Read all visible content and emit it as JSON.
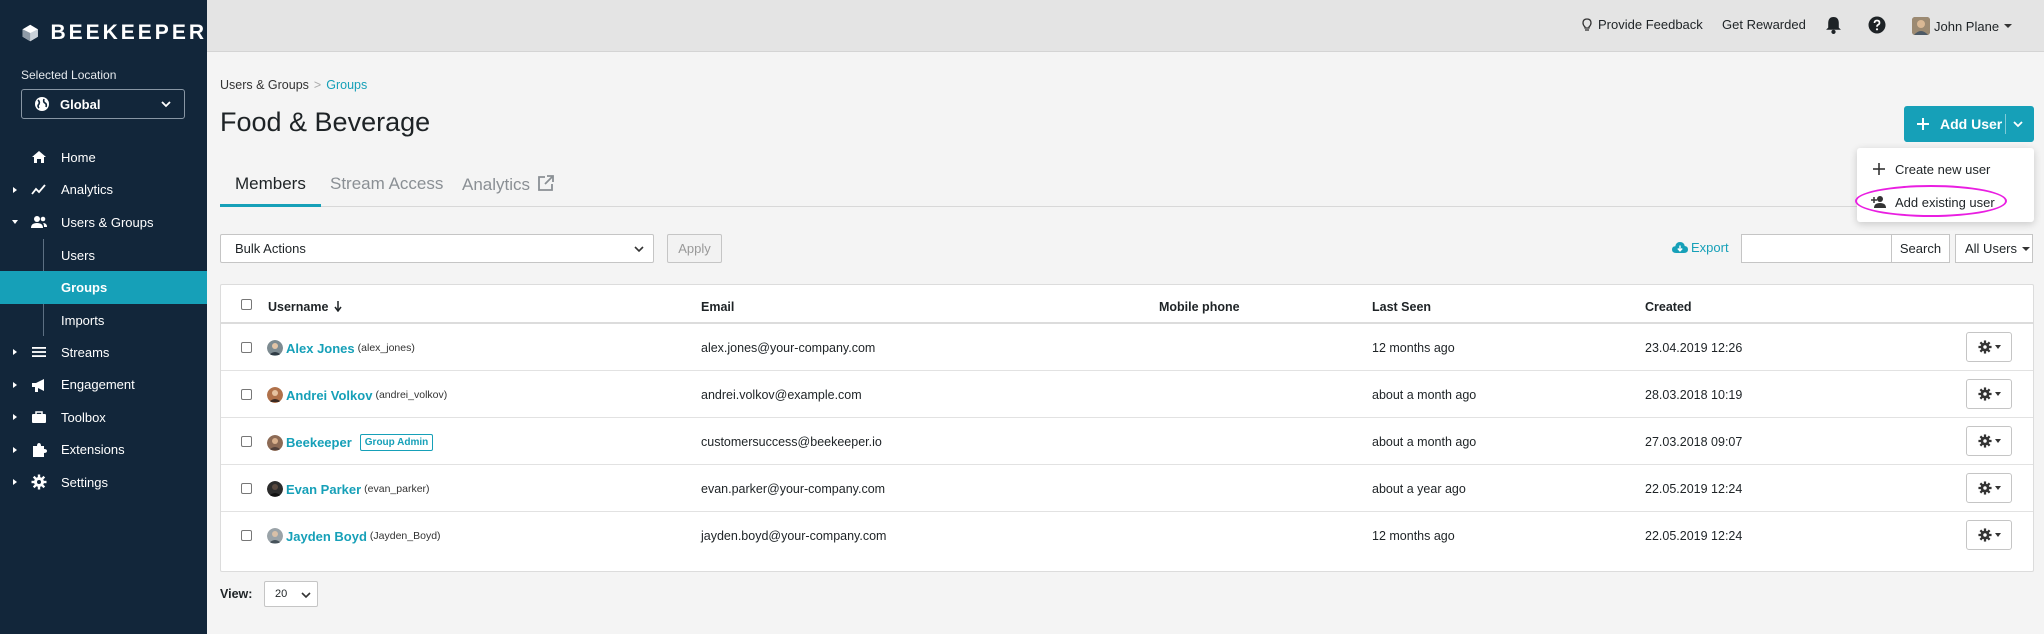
{
  "brand": {
    "name": "BEEKEEPER"
  },
  "location": {
    "label": "Selected Location",
    "value": "Global"
  },
  "sidebar": {
    "items": [
      {
        "label": "Home",
        "icon": "home-icon"
      },
      {
        "label": "Analytics",
        "icon": "analytics-icon"
      },
      {
        "label": "Users & Groups",
        "icon": "users-icon"
      },
      {
        "label": "Users"
      },
      {
        "label": "Groups"
      },
      {
        "label": "Imports"
      },
      {
        "label": "Streams",
        "icon": "streams-icon"
      },
      {
        "label": "Engagement",
        "icon": "megaphone-icon"
      },
      {
        "label": "Toolbox",
        "icon": "toolbox-icon"
      },
      {
        "label": "Extensions",
        "icon": "puzzle-icon"
      },
      {
        "label": "Settings",
        "icon": "gear-icon"
      }
    ]
  },
  "topbar": {
    "feedback": "Provide Feedback",
    "rewarded": "Get Rewarded",
    "user_name": "John Plane"
  },
  "breadcrumb": {
    "parent": "Users & Groups",
    "separator": ">",
    "current": "Groups"
  },
  "page": {
    "title": "Food & Beverage"
  },
  "tabs": [
    {
      "label": "Members"
    },
    {
      "label": "Stream Access"
    },
    {
      "label": "Analytics"
    }
  ],
  "add_user": {
    "label": "Add User",
    "menu": [
      {
        "label": "Create new user"
      },
      {
        "label": "Add existing user"
      }
    ]
  },
  "toolbar": {
    "bulk_actions": "Bulk Actions",
    "apply": "Apply",
    "export": "Export",
    "search_placeholder": "",
    "search": "Search",
    "filter": "All Users"
  },
  "table": {
    "columns": [
      "Username",
      "Email",
      "Mobile phone",
      "Last Seen",
      "Created"
    ],
    "rows": [
      {
        "name": "Alex Jones",
        "handle": "(alex_jones)",
        "badge": "",
        "email": "alex.jones@your-company.com",
        "phone": "",
        "last_seen": "12 months ago",
        "created": "23.04.2019 12:26"
      },
      {
        "name": "Andrei Volkov",
        "handle": "(andrei_volkov)",
        "badge": "",
        "email": "andrei.volkov@example.com",
        "phone": "",
        "last_seen": "about a month ago",
        "created": "28.03.2018 10:19"
      },
      {
        "name": "Beekeeper",
        "handle": "",
        "badge": "Group Admin",
        "email": "customersuccess@beekeeper.io",
        "phone": "",
        "last_seen": "about a month ago",
        "created": "27.03.2018 09:07"
      },
      {
        "name": "Evan Parker",
        "handle": "(evan_parker)",
        "badge": "",
        "email": "evan.parker@your-company.com",
        "phone": "",
        "last_seen": "about a year ago",
        "created": "22.05.2019 12:24"
      },
      {
        "name": "Jayden Boyd",
        "handle": "(Jayden_Boyd)",
        "badge": "",
        "email": "jayden.boyd@your-company.com",
        "phone": "",
        "last_seen": "12 months ago",
        "created": "22.05.2019 12:24"
      }
    ]
  },
  "pagination": {
    "view_label": "View:",
    "page_size": "20"
  },
  "colors": {
    "accent": "#16a0b8",
    "sidebar": "#12263a",
    "highlight": "#e91ee1"
  }
}
